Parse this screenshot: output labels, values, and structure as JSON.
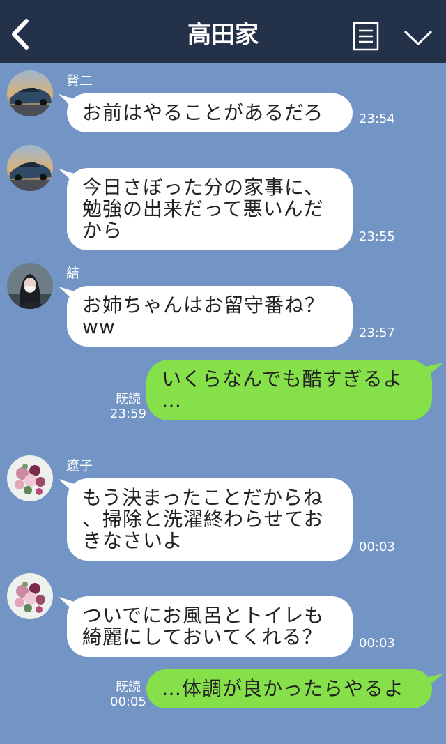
{
  "header": {
    "title": "高田家"
  },
  "messages": [
    {
      "sender": "賢二",
      "lines": [
        "お前はやることがあるだろ"
      ],
      "time": "23:54"
    },
    {
      "lines": [
        "今日さぼった分の家事に、",
        "勉強の出来だって悪いんだ",
        "から"
      ],
      "time": "23:55"
    },
    {
      "sender": "結",
      "lines": [
        "お姉ちゃんはお留守番ね？",
        "ww"
      ],
      "time": "23:57"
    },
    {
      "lines": [
        "いくらなんでも酷すぎるよ",
        "…"
      ],
      "read": "既読",
      "time": "23:59"
    },
    {
      "sender": "遼子",
      "lines": [
        "もう決まったことだからね",
        "、掃除と洗濯終わらせてお",
        "きなさいよ"
      ],
      "time": "00:03"
    },
    {
      "lines": [
        "ついでにお風呂とトイレも",
        "綺麗にしておいてくれる？"
      ],
      "time": "00:03"
    },
    {
      "lines": [
        "…体調が良かったらやるよ"
      ],
      "read": "既読",
      "time": "00:05"
    }
  ]
}
